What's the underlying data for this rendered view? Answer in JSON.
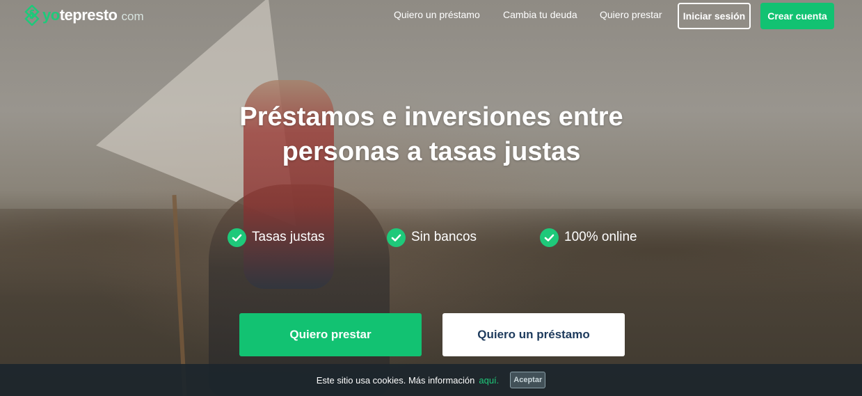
{
  "brand": {
    "logo_main": "yo",
    "logo_rest": "tepresto",
    "logo_suffix": "com",
    "accent_color": "#12c272"
  },
  "nav": {
    "links": [
      "Quiero un préstamo",
      "Cambia tu deuda",
      "Quiero prestar"
    ],
    "login_label": "Iniciar sesión",
    "signup_label": "Crear cuenta"
  },
  "hero": {
    "headline": {
      "line1_bold1": "Préstamos",
      "line1_mid": "e",
      "line1_bold2": "inversiones",
      "line1_end": "entre",
      "line2_start": "personas a",
      "line2_bold": "tasas justas"
    },
    "features": [
      {
        "icon": "check-icon",
        "label": "Tasas justas"
      },
      {
        "icon": "check-icon",
        "label": "Sin bancos"
      },
      {
        "icon": "check-icon",
        "label": "100% online"
      }
    ],
    "cta_lend": "Quiero prestar",
    "cta_loan": "Quiero un préstamo"
  },
  "cookie": {
    "text": "Este sitio usa cookies. Más información",
    "link": "aquí.",
    "accept": "Aceptar"
  }
}
